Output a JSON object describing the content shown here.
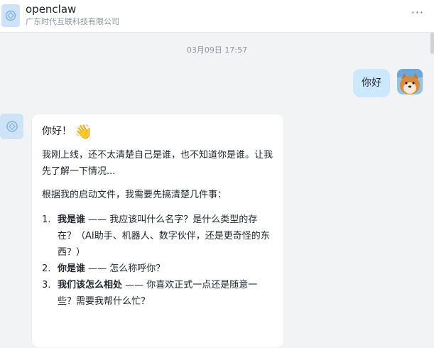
{
  "header": {
    "title": "openclaw",
    "subtitle": "广东时代互联科技有限公司",
    "more_icon": "···"
  },
  "timestamp": "03月09日 17:57",
  "user_message": {
    "text": "你好",
    "avatar_icon": "shiba-dog-avatar"
  },
  "bot_message": {
    "avatar_icon": "openclaw-bot-avatar",
    "greeting": "你好！",
    "wave_emoji": "👋",
    "para1": "我刚上线，还不太清楚自己是谁，也不知道你是谁。让我先了解一下情况...",
    "para2": "根据我的启动文件，我需要先搞清楚几件事：",
    "items": [
      {
        "num": "1.",
        "bold": "我是谁",
        "text": " —— 我应该叫什么名字？是什么类型的存在？（AI助手、机器人、数字伙伴，还是更奇怪的东西？）"
      },
      {
        "num": "2.",
        "bold": "你是谁",
        "text": " —— 怎么称呼你？"
      },
      {
        "num": "3.",
        "bold": "我们该怎么相处",
        "text": " —— 你喜欢正式一点还是随意一些？需要我帮什么忙？"
      }
    ]
  },
  "colors": {
    "user_bubble": "#cce8ff",
    "bot_avatar_bg": "#cfe3f7",
    "background": "#f2f3f5"
  }
}
